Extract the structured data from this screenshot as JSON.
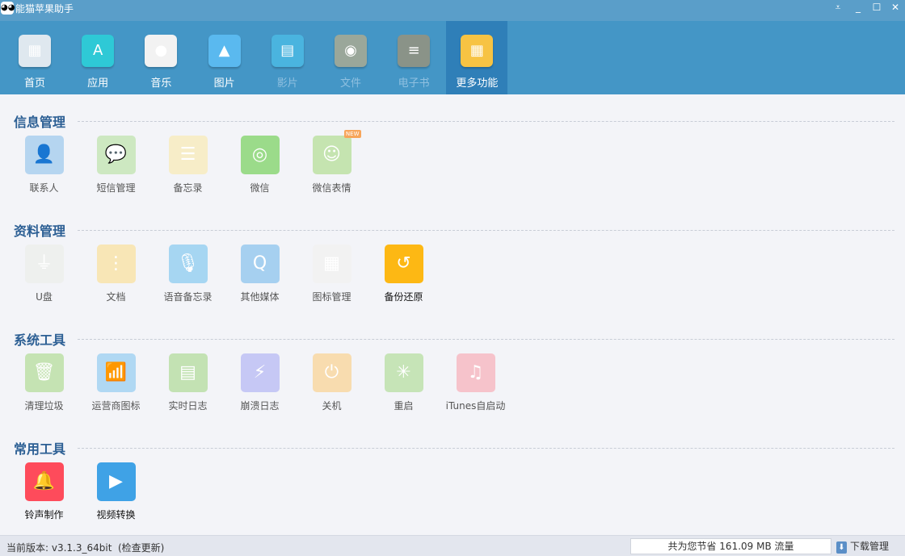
{
  "app": {
    "title": "能猫苹果助手"
  },
  "toolbar": {
    "tabs": [
      {
        "label": "首页",
        "color": "#dfe8ef",
        "glyph": "▦"
      },
      {
        "label": "应用",
        "color": "#2ec9d6",
        "glyph": "A"
      },
      {
        "label": "音乐",
        "color": "#f2f2f2",
        "glyph": "●"
      },
      {
        "label": "图片",
        "color": "#5ab9ef",
        "glyph": "▲"
      },
      {
        "label": "影片",
        "color": "#4ab4df",
        "glyph": "▤"
      },
      {
        "label": "文件",
        "color": "#9aa79a",
        "glyph": "◉"
      },
      {
        "label": "电子书",
        "color": "#8a9388",
        "glyph": "≡"
      },
      {
        "label": "更多功能",
        "color": "#f7c343",
        "glyph": "▦"
      }
    ]
  },
  "sections": [
    {
      "title": "信息管理",
      "items": [
        {
          "label": "联系人",
          "color": "#b5d5f0",
          "glyph": "👤"
        },
        {
          "label": "短信管理",
          "color": "#cde8c1",
          "glyph": "💬"
        },
        {
          "label": "备忘录",
          "color": "#f7edc8",
          "glyph": "☰"
        },
        {
          "label": "微信",
          "color": "#9bdb8a",
          "glyph": "◎"
        },
        {
          "label": "微信表情",
          "color": "#c5e4b0",
          "glyph": "☺",
          "badge": "NEW"
        }
      ]
    },
    {
      "title": "资料管理",
      "items": [
        {
          "label": "U盘",
          "color": "#eef0ee",
          "glyph": "⏚"
        },
        {
          "label": "文档",
          "color": "#f8e6b6",
          "glyph": "⋮"
        },
        {
          "label": "语音备忘录",
          "color": "#a6d6f2",
          "glyph": "🎙"
        },
        {
          "label": "其他媒体",
          "color": "#a6d0f0",
          "glyph": "Q"
        },
        {
          "label": "图标管理",
          "color": "#f2f2f2",
          "glyph": "▦"
        },
        {
          "label": "备份还原",
          "color": "#fdb814",
          "glyph": "↺",
          "bold": true
        }
      ]
    },
    {
      "title": "系统工具",
      "items": [
        {
          "label": "清理垃圾",
          "color": "#c5e3b3",
          "glyph": "🗑"
        },
        {
          "label": "运营商图标",
          "color": "#b0d8f3",
          "glyph": "📶"
        },
        {
          "label": "实时日志",
          "color": "#c3e2b3",
          "glyph": "▤"
        },
        {
          "label": "崩溃日志",
          "color": "#c6c8f5",
          "glyph": "⚡"
        },
        {
          "label": "关机",
          "color": "#f8dcaf",
          "glyph": "⏻"
        },
        {
          "label": "重启",
          "color": "#c6e4b7",
          "glyph": "✳"
        },
        {
          "label": "iTunes自启动",
          "color": "#f6c3cb",
          "glyph": "♫"
        }
      ]
    },
    {
      "title": "常用工具",
      "items": [
        {
          "label": "铃声制作",
          "color": "#fe4b5b",
          "glyph": "🔔",
          "bold": true
        },
        {
          "label": "视频转换",
          "color": "#3fa2e6",
          "glyph": "▶",
          "bold": true
        }
      ]
    }
  ],
  "status": {
    "version": "当前版本: v3.1.3_64bit",
    "check_update": "(检查更新)",
    "saved": "共为您节省  161.09 MB 流量",
    "download": "下载管理",
    "download_glyph": "⬇"
  }
}
